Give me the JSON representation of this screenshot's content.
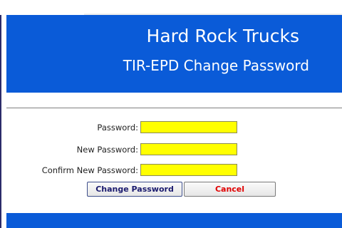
{
  "header": {
    "title": "Hard Rock Trucks",
    "subtitle": "TIR-EPD Change Password"
  },
  "form": {
    "password_label": "Password:",
    "password_value": "",
    "new_password_label": "New Password:",
    "new_password_value": "",
    "confirm_password_label": "Confirm New Password:",
    "confirm_password_value": ""
  },
  "buttons": {
    "change_label": "Change Password",
    "cancel_label": "Cancel"
  },
  "colors": {
    "header_bg": "#0a5bd8",
    "input_bg": "#ffff00",
    "cancel_text": "#e00000"
  }
}
